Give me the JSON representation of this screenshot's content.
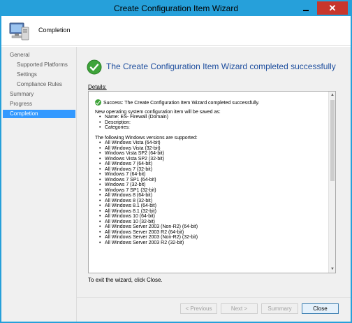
{
  "window": {
    "title": "Create Configuration Item Wizard",
    "close_glyph": "✕"
  },
  "banner": {
    "title": "Completion",
    "icon": "computer-icon"
  },
  "nav": {
    "items": [
      {
        "label": "General",
        "level": 0,
        "active": false
      },
      {
        "label": "Supported Platforms",
        "level": 1,
        "active": false
      },
      {
        "label": "Settings",
        "level": 1,
        "active": false
      },
      {
        "label": "Compliance Rules",
        "level": 1,
        "active": false
      },
      {
        "label": "Summary",
        "level": 0,
        "active": false
      },
      {
        "label": "Progress",
        "level": 0,
        "active": false
      },
      {
        "label": "Completion",
        "level": 0,
        "active": true
      }
    ]
  },
  "main": {
    "headline": "The Create Configuration Item Wizard completed successfully",
    "details_label": "Details:",
    "success_line": "Success: The Create Configuration Item Wizard completed successfully.",
    "saved_intro": "New operating system configuration item will be saved as:",
    "saved_items": [
      "Name: ES- Firewall (Domain)",
      "Description:",
      "Categories:"
    ],
    "versions_intro": "The following Windows versions are supported:",
    "versions": [
      "All Windows Vista (64-bit)",
      "All Windows Vista (32-bit)",
      "Windows Vista SP2 (64-bit)",
      "Windows Vista SP2 (32-bit)",
      "All Windows 7 (64-bit)",
      "All Windows 7 (32-bit)",
      "Windows 7 (64-bit)",
      "Windows 7 SP1 (64-bit)",
      "Windows 7 (32-bit)",
      "Windows 7 SP1 (32-bit)",
      "All Windows 8 (64-bit)",
      "All Windows 8 (32-bit)",
      "All Windows 8.1 (64-bit)",
      "All Windows 8.1 (32-bit)",
      "All Windows 10 (64-bit)",
      "All Windows 10 (32-bit)",
      "All Windows Server 2003 (Non-R2) (64-bit)",
      "All Windows Server 2003 R2 (64-bit)",
      "All Windows Server 2003 (Non-R2) (32-bit)",
      "All Windows Server 2003 R2 (32-bit)"
    ],
    "exit_text": "To exit the wizard, click Close."
  },
  "footer": {
    "previous_label": "< Previous",
    "next_label": "Next >",
    "summary_label": "Summary",
    "close_label": "Close"
  },
  "colors": {
    "titlebar": "#26a0da",
    "close_button": "#c7362c",
    "nav_active": "#3399ff",
    "headline": "#1e4e9e",
    "success_green": "#3ea33a"
  }
}
